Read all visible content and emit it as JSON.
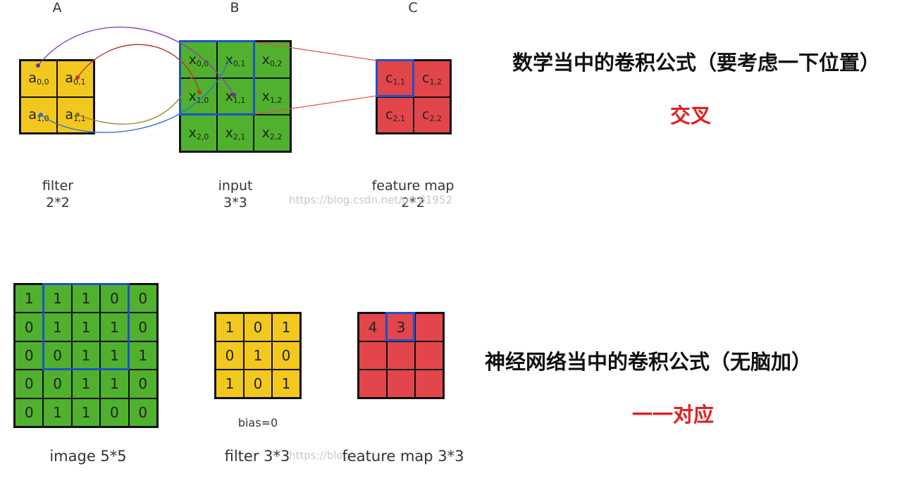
{
  "top": {
    "labels": {
      "a": "A",
      "b": "B",
      "c": "C"
    },
    "filter": {
      "cells": [
        [
          "a",
          "0,0"
        ],
        [
          "a",
          "0,1"
        ],
        [
          "a",
          "1,0"
        ],
        [
          "a",
          "1,1"
        ]
      ],
      "caption_line1": "filter",
      "caption_line2": "2*2"
    },
    "input": {
      "cells": [
        [
          "x",
          "0,0"
        ],
        [
          "x",
          "0,1"
        ],
        [
          "x",
          "0,2"
        ],
        [
          "x",
          "1,0"
        ],
        [
          "x",
          "1,1"
        ],
        [
          "x",
          "1,2"
        ],
        [
          "x",
          "2,0"
        ],
        [
          "x",
          "2,1"
        ],
        [
          "x",
          "2,2"
        ]
      ],
      "caption_line1": "input",
      "caption_line2": "3*3"
    },
    "feature": {
      "cells": [
        [
          "c",
          "1,1"
        ],
        [
          "c",
          "1,2"
        ],
        [
          "c",
          "2,1"
        ],
        [
          "c",
          "2,2"
        ]
      ],
      "caption_line1": "feature map",
      "caption_line2": "2*2"
    },
    "watermark": "https://blog.csdn.net/u0  81952"
  },
  "bottom": {
    "image": {
      "cells": [
        "1",
        "1",
        "1",
        "0",
        "0",
        "0",
        "1",
        "1",
        "1",
        "0",
        "0",
        "0",
        "1",
        "1",
        "1",
        "0",
        "0",
        "1",
        "1",
        "0",
        "0",
        "1",
        "1",
        "0",
        "0"
      ],
      "caption": "image 5*5"
    },
    "filter": {
      "cells": [
        "1",
        "0",
        "1",
        "0",
        "1",
        "0",
        "1",
        "0",
        "1"
      ],
      "bias": "bias=0",
      "caption": "filter 3*3"
    },
    "feature": {
      "cells": [
        "4",
        "3",
        "",
        "",
        "",
        "",
        "",
        "",
        ""
      ],
      "caption": "feature map 3*3"
    },
    "watermark": "https://blog"
  },
  "right": {
    "heading1": "数学当中的卷积公式（要考虑一下位置）",
    "subtitle1": "交叉",
    "heading2": "神经网络当中的卷积公式（无脑加）",
    "subtitle2": "一一对应"
  },
  "colors": {
    "yellow": "#f2c81e",
    "green": "#4fb12d",
    "red": "#e2454a",
    "highlight": "#1f52c8",
    "accent_text": "#e02020"
  }
}
